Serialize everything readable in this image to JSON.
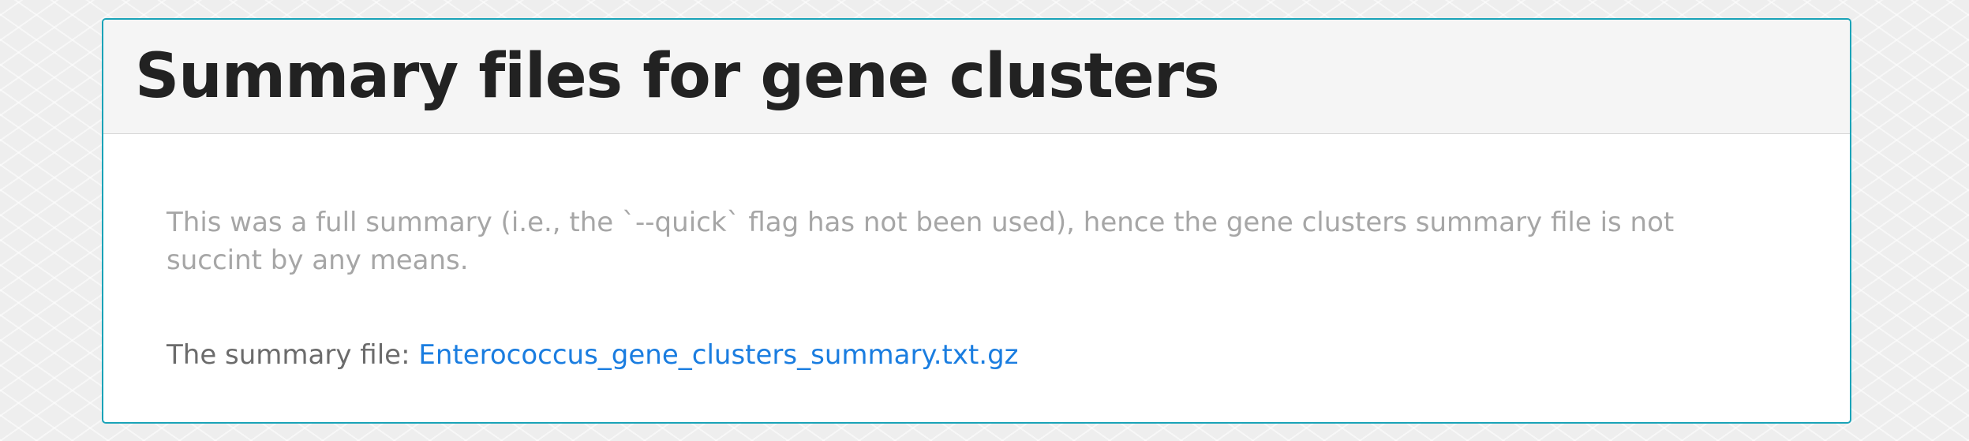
{
  "panel": {
    "title": "Summary files for gene clusters",
    "note": "This was a full summary (i.e., the `--quick` flag has not been used), hence the gene clusters summary file is not succint by any means.",
    "file_label": "The summary file:",
    "file_link": "Enterococcus_gene_clusters_summary.txt.gz"
  },
  "colors": {
    "panel_border": "#1aa3b8",
    "link": "#1a7de0",
    "note_text": "#a6a6a6",
    "title_text": "#222222"
  }
}
